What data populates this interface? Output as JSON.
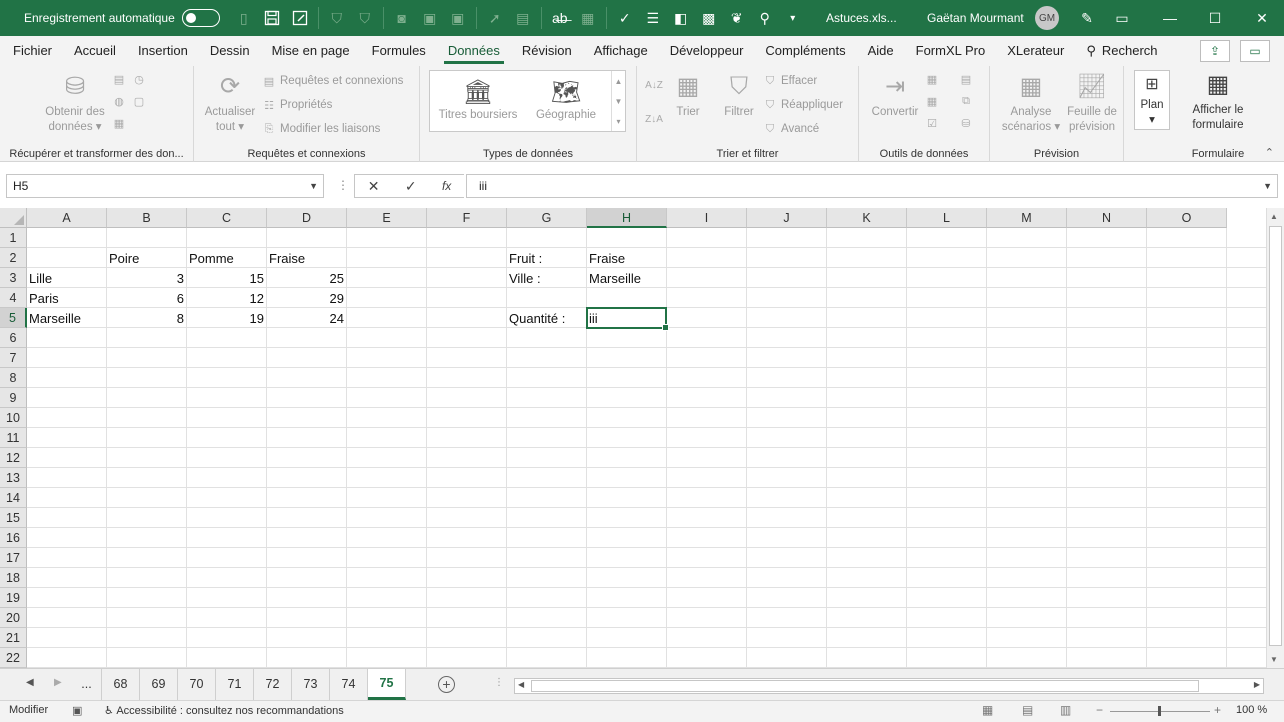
{
  "titlebar": {
    "autosave_label": "Enregistrement automatique",
    "filename": "Astuces.xls...",
    "user": "Gaëtan Mourmant",
    "initials": "GM"
  },
  "tabs": [
    "Fichier",
    "Accueil",
    "Insertion",
    "Dessin",
    "Mise en page",
    "Formules",
    "Données",
    "Révision",
    "Affichage",
    "Développeur",
    "Compléments",
    "Aide",
    "FormXL Pro",
    "XLerateur"
  ],
  "active_tab": "Données",
  "search_label": "Recherch",
  "ribbon": {
    "get_data": "Obtenir des données",
    "refresh_all": "Actualiser tout",
    "queries_connections": "Requêtes et connexions",
    "properties": "Propriétés",
    "edit_links": "Modifier les liaisons",
    "stocks": "Titres boursiers",
    "geography": "Géographie",
    "sort": "Trier",
    "filter": "Filtrer",
    "clear": "Effacer",
    "reapply": "Réappliquer",
    "advanced": "Avancé",
    "text_to_columns": "Convertir",
    "what_if": "Analyse scénarios",
    "forecast_sheet": "Feuille de prévision",
    "outline": "Plan",
    "show_form": "Afficher le formulaire",
    "groups": {
      "get_transform": "Récupérer et transformer des don...",
      "queries": "Requêtes et connexions",
      "data_types": "Types de données",
      "sort_filter": "Trier et filtrer",
      "data_tools": "Outils de données",
      "forecast": "Prévision",
      "form": "Formulaire"
    }
  },
  "formula_bar": {
    "name_box": "H5",
    "content": "iii"
  },
  "columns": [
    "A",
    "B",
    "C",
    "D",
    "E",
    "F",
    "G",
    "H",
    "I",
    "J",
    "K",
    "L",
    "M",
    "N",
    "O"
  ],
  "selected_column": "H",
  "rows": [
    "1",
    "2",
    "3",
    "4",
    "5",
    "6",
    "7",
    "8",
    "9",
    "10",
    "11",
    "12",
    "13",
    "14",
    "15",
    "16",
    "17",
    "18",
    "19",
    "20",
    "21",
    "22"
  ],
  "selected_row": "5",
  "cells": {
    "B2": "Poire",
    "C2": "Pomme",
    "D2": "Fraise",
    "A3": "Lille",
    "B3": "3",
    "C3": "15",
    "D3": "25",
    "A4": "Paris",
    "B4": "6",
    "C4": "12",
    "D4": "29",
    "A5": "Marseille",
    "B5": "8",
    "C5": "19",
    "D5": "24",
    "G2": "Fruit :",
    "H2": "Fraise",
    "G3": "Ville :",
    "H3": "Marseille",
    "G5": "Quantité :",
    "H5": "iii"
  },
  "sheets": {
    "ellipsis": "...",
    "tabs": [
      "68",
      "69",
      "70",
      "71",
      "72",
      "73",
      "74",
      "75"
    ],
    "active": "75"
  },
  "status": {
    "mode": "Modifier",
    "accessibility": "Accessibilité : consultez nos recommandations",
    "zoom": "100 %"
  },
  "colors": {
    "accent": "#217346"
  }
}
